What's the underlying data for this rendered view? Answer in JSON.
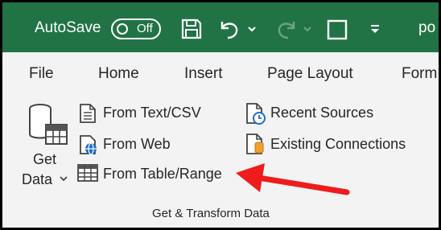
{
  "titlebar": {
    "autosave_label": "AutoSave",
    "toggle_state": "Off",
    "filename_partial": "po",
    "accent_color": "#217346"
  },
  "tabs": [
    "File",
    "Home",
    "Insert",
    "Page Layout",
    "Form"
  ],
  "get_data": {
    "line1": "Get",
    "line2": "Data"
  },
  "commands": {
    "from_text_csv": "From Text/CSV",
    "from_web": "From Web",
    "from_table_range": "From Table/Range",
    "recent_sources": "Recent Sources",
    "existing_connections": "Existing Connections"
  },
  "group_label": "Get & Transform Data",
  "annotation": {
    "arrow_color": "#ee1c1c",
    "points_to": "from_table_range"
  },
  "icons": [
    "save-icon",
    "undo-icon",
    "redo-icon",
    "window-icon",
    "customize-icon",
    "database-table-icon",
    "text-file-icon",
    "web-icon",
    "table-icon",
    "recent-sources-icon",
    "existing-connections-icon"
  ]
}
